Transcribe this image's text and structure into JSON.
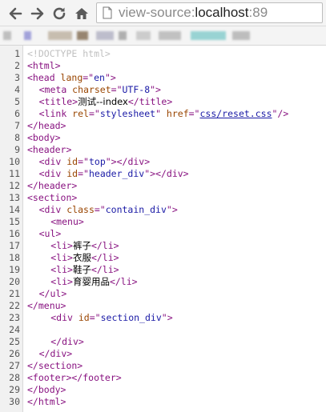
{
  "browser": {
    "url_scheme": "view-source:",
    "url_host": "localhost",
    "url_port": ":89",
    "icons": [
      "back-arrow-icon",
      "forward-arrow-icon",
      "reload-icon",
      "home-icon",
      "page-icon"
    ],
    "bookmark_colors": [
      "#b9b9b9",
      "#9a9ad8",
      "#c3b8a8",
      "#8e7a62",
      "#b8b8c8",
      "#a8a8a8",
      "#c8c8c8",
      "#bcbcbc",
      "#8fd0d0",
      "#b8b8b8"
    ]
  },
  "source": {
    "lines": [
      {
        "n": "1",
        "seg": [
          {
            "c": "doctype",
            "t": "<!DOCTYPE html>"
          }
        ]
      },
      {
        "n": "2",
        "seg": [
          {
            "c": "tag",
            "t": "<html>"
          }
        ]
      },
      {
        "n": "3",
        "seg": [
          {
            "c": "tag",
            "t": "<head "
          },
          {
            "c": "attr",
            "t": "lang"
          },
          {
            "c": "tag",
            "t": "=\""
          },
          {
            "c": "val",
            "t": "en"
          },
          {
            "c": "tag",
            "t": "\">"
          }
        ]
      },
      {
        "n": "4",
        "seg": [
          {
            "c": "txt",
            "t": "    "
          },
          {
            "c": "tag",
            "t": "<meta "
          },
          {
            "c": "attr",
            "t": "charset"
          },
          {
            "c": "tag",
            "t": "=\""
          },
          {
            "c": "val",
            "t": "UTF-8"
          },
          {
            "c": "tag",
            "t": "\">"
          }
        ]
      },
      {
        "n": "5",
        "seg": [
          {
            "c": "txt",
            "t": "    "
          },
          {
            "c": "tag",
            "t": "<title>"
          },
          {
            "c": "txt",
            "t": "测试--index"
          },
          {
            "c": "tag",
            "t": "</title>"
          }
        ]
      },
      {
        "n": "6",
        "seg": [
          {
            "c": "txt",
            "t": "    "
          },
          {
            "c": "tag",
            "t": "<link "
          },
          {
            "c": "attr",
            "t": "rel"
          },
          {
            "c": "tag",
            "t": "=\""
          },
          {
            "c": "val",
            "t": "stylesheet"
          },
          {
            "c": "tag",
            "t": "\" "
          },
          {
            "c": "attr",
            "t": "href"
          },
          {
            "c": "tag",
            "t": "=\""
          },
          {
            "c": "link",
            "t": "css/reset.css"
          },
          {
            "c": "tag",
            "t": "\"/>"
          }
        ]
      },
      {
        "n": "7",
        "seg": [
          {
            "c": "tag",
            "t": "</head>"
          }
        ]
      },
      {
        "n": "8",
        "seg": [
          {
            "c": "tag",
            "t": "<body>"
          }
        ]
      },
      {
        "n": "9",
        "seg": [
          {
            "c": "tag",
            "t": "<header>"
          }
        ]
      },
      {
        "n": "10",
        "seg": [
          {
            "c": "txt",
            "t": "    "
          },
          {
            "c": "tag",
            "t": "<div "
          },
          {
            "c": "attr",
            "t": "id"
          },
          {
            "c": "tag",
            "t": "=\""
          },
          {
            "c": "val",
            "t": "top"
          },
          {
            "c": "tag",
            "t": "\"></div>"
          }
        ]
      },
      {
        "n": "11",
        "seg": [
          {
            "c": "txt",
            "t": "    "
          },
          {
            "c": "tag",
            "t": "<div "
          },
          {
            "c": "attr",
            "t": "id"
          },
          {
            "c": "tag",
            "t": "=\""
          },
          {
            "c": "val",
            "t": "header_div"
          },
          {
            "c": "tag",
            "t": "\"></div>"
          }
        ]
      },
      {
        "n": "12",
        "seg": [
          {
            "c": "tag",
            "t": "</header>"
          }
        ]
      },
      {
        "n": "13",
        "seg": [
          {
            "c": "tag",
            "t": "<section>"
          }
        ]
      },
      {
        "n": "14",
        "seg": [
          {
            "c": "txt",
            "t": "    "
          },
          {
            "c": "tag",
            "t": "<div "
          },
          {
            "c": "attr",
            "t": "class"
          },
          {
            "c": "tag",
            "t": "=\""
          },
          {
            "c": "val",
            "t": "contain_div"
          },
          {
            "c": "tag",
            "t": "\">"
          }
        ]
      },
      {
        "n": "15",
        "seg": [
          {
            "c": "txt",
            "t": "        "
          },
          {
            "c": "tag",
            "t": "<menu>"
          }
        ]
      },
      {
        "n": "16",
        "seg": [
          {
            "c": "txt",
            "t": "    "
          },
          {
            "c": "tag",
            "t": "<ul>"
          }
        ]
      },
      {
        "n": "17",
        "seg": [
          {
            "c": "txt",
            "t": "        "
          },
          {
            "c": "tag",
            "t": "<li>"
          },
          {
            "c": "txt",
            "t": "裤子"
          },
          {
            "c": "tag",
            "t": "</li>"
          }
        ]
      },
      {
        "n": "18",
        "seg": [
          {
            "c": "txt",
            "t": "        "
          },
          {
            "c": "tag",
            "t": "<li>"
          },
          {
            "c": "txt",
            "t": "衣服"
          },
          {
            "c": "tag",
            "t": "</li>"
          }
        ]
      },
      {
        "n": "19",
        "seg": [
          {
            "c": "txt",
            "t": "        "
          },
          {
            "c": "tag",
            "t": "<li>"
          },
          {
            "c": "txt",
            "t": "鞋子"
          },
          {
            "c": "tag",
            "t": "</li>"
          }
        ]
      },
      {
        "n": "20",
        "seg": [
          {
            "c": "txt",
            "t": "        "
          },
          {
            "c": "tag",
            "t": "<li>"
          },
          {
            "c": "txt",
            "t": "育婴用品"
          },
          {
            "c": "tag",
            "t": "</li>"
          }
        ]
      },
      {
        "n": "21",
        "seg": [
          {
            "c": "txt",
            "t": "    "
          },
          {
            "c": "tag",
            "t": "</ul>"
          }
        ]
      },
      {
        "n": "22",
        "seg": [
          {
            "c": "tag",
            "t": "</menu>"
          }
        ]
      },
      {
        "n": "23",
        "seg": [
          {
            "c": "txt",
            "t": "        "
          },
          {
            "c": "tag",
            "t": "<div "
          },
          {
            "c": "attr",
            "t": "id"
          },
          {
            "c": "tag",
            "t": "=\""
          },
          {
            "c": "val",
            "t": "section_div"
          },
          {
            "c": "tag",
            "t": "\">"
          }
        ]
      },
      {
        "n": "24",
        "seg": []
      },
      {
        "n": "25",
        "seg": [
          {
            "c": "txt",
            "t": "        "
          },
          {
            "c": "tag",
            "t": "</div>"
          }
        ]
      },
      {
        "n": "26",
        "seg": [
          {
            "c": "txt",
            "t": "    "
          },
          {
            "c": "tag",
            "t": "</div>"
          }
        ]
      },
      {
        "n": "27",
        "seg": [
          {
            "c": "tag",
            "t": "</section>"
          }
        ]
      },
      {
        "n": "28",
        "seg": [
          {
            "c": "tag",
            "t": "<footer></footer>"
          }
        ]
      },
      {
        "n": "29",
        "seg": [
          {
            "c": "tag",
            "t": "</body>"
          }
        ]
      },
      {
        "n": "30",
        "seg": [
          {
            "c": "tag",
            "t": "</html>"
          }
        ]
      }
    ]
  }
}
